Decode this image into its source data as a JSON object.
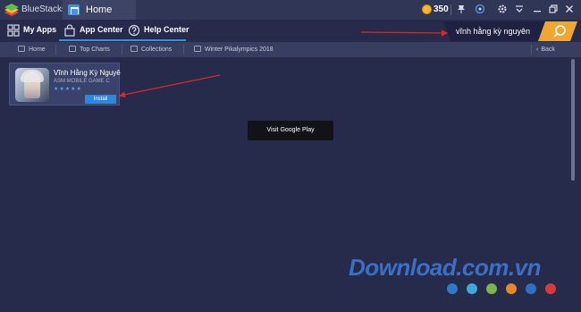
{
  "titlebar": {
    "app_name": "BlueStacks",
    "tab_label": "Home",
    "coins": "350"
  },
  "nav": {
    "items": [
      {
        "label": "My Apps",
        "icon": "grid-icon"
      },
      {
        "label": "App Center",
        "icon": "shopping-bag-icon"
      },
      {
        "label": "Help Center",
        "icon": "question-circle-icon"
      }
    ],
    "search_value": "vĩnh hằng kỳ nguyên"
  },
  "subnav": {
    "items": [
      "Home",
      "Top Charts",
      "Collections",
      "Winter Pikalympics 2018"
    ],
    "back_label": "Back"
  },
  "result": {
    "title": "Vĩnh Hằng Kỳ Nguyê",
    "developer": "ASM MOBILE GAME C",
    "stars": "★★★★★",
    "install_label": "Install"
  },
  "visit_label": "Visit Google Play",
  "watermark": {
    "text": "Download.com.vn",
    "dot_colors": [
      "#2e79c8",
      "#3fa8d8",
      "#7ab648",
      "#e8872a",
      "#2d6fc2",
      "#d63b3b"
    ]
  },
  "colors": {
    "accent": "#3b8fd9",
    "search_bg": "#f0a632",
    "background": "#262b4c"
  }
}
